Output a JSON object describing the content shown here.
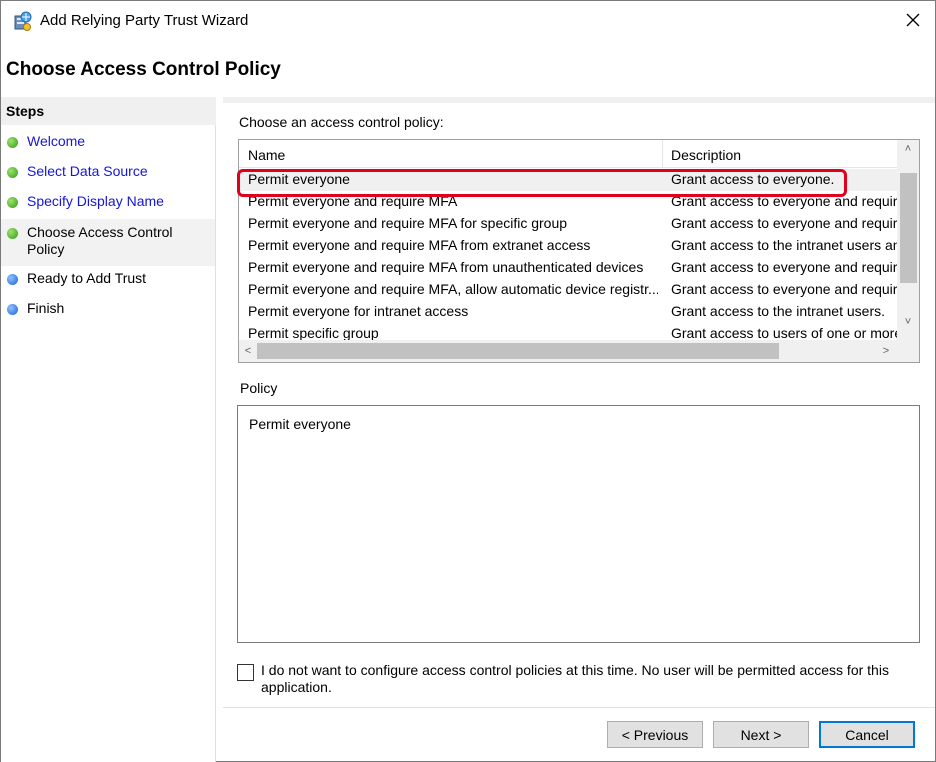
{
  "window": {
    "title": "Add Relying Party Trust Wizard",
    "app_icon": "server-trust-icon",
    "close_icon": "close-icon"
  },
  "page": {
    "header": "Choose Access Control Policy"
  },
  "sidebar": {
    "title": "Steps",
    "items": [
      {
        "label": "Welcome",
        "state": "done"
      },
      {
        "label": "Select Data Source",
        "state": "done"
      },
      {
        "label": "Specify Display Name",
        "state": "done"
      },
      {
        "label": "Choose Access Control Policy",
        "state": "current"
      },
      {
        "label": "Ready to Add Trust",
        "state": "pending"
      },
      {
        "label": "Finish",
        "state": "pending"
      }
    ]
  },
  "main": {
    "choose_label": "Choose an access control policy:",
    "columns": [
      "Name",
      "Description"
    ],
    "rows": [
      {
        "name": "Permit everyone",
        "description": "Grant access to everyone."
      },
      {
        "name": "Permit everyone and require MFA",
        "description": "Grant access to everyone and requir"
      },
      {
        "name": "Permit everyone and require MFA for specific group",
        "description": "Grant access to everyone and requir"
      },
      {
        "name": "Permit everyone and require MFA from extranet access",
        "description": "Grant access to the intranet users an"
      },
      {
        "name": "Permit everyone and require MFA from unauthenticated devices",
        "description": "Grant access to everyone and requir"
      },
      {
        "name": "Permit everyone and require MFA, allow automatic device registr...",
        "description": "Grant access to everyone and requir"
      },
      {
        "name": "Permit everyone for intranet access",
        "description": "Grant access to the intranet users."
      },
      {
        "name": "Permit specific group",
        "description": "Grant access to users of one or more"
      }
    ],
    "selected_row": 0,
    "policy_label": "Policy",
    "policy_text": "Permit everyone",
    "checkbox_label": "I do not want to configure access control policies at this time. No user will be permitted access for this application.",
    "checkbox_checked": false
  },
  "buttons": {
    "previous": "< Previous",
    "next": "Next >",
    "cancel": "Cancel"
  },
  "colors": {
    "highlight": "#e0001b",
    "link": "#1515d6",
    "done_dot": "#2f9a1a",
    "pending_dot": "#1a5fd0",
    "default_button_border": "#0078d7"
  }
}
